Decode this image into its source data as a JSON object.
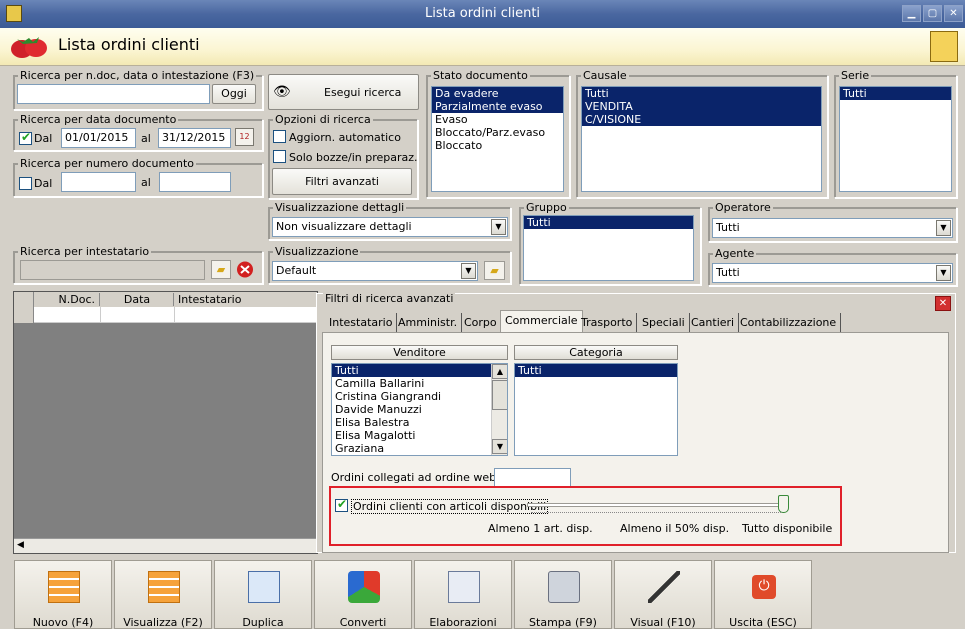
{
  "window": {
    "title": "Lista ordini clienti"
  },
  "header": {
    "title": "Lista ordini clienti"
  },
  "search_general": {
    "legend": "Ricerca per n.doc, data o intestazione (F3)",
    "value": "",
    "today_btn": "Oggi"
  },
  "run_search": {
    "label": "Esegui ricerca"
  },
  "search_date": {
    "legend": "Ricerca per data documento",
    "from_label": "Dal",
    "from": "01/01/2015",
    "to_label": "al",
    "to": "31/12/2015"
  },
  "search_number": {
    "legend": "Ricerca per numero documento",
    "from_label": "Dal",
    "to_label": "al"
  },
  "options": {
    "legend": "Opzioni di ricerca",
    "auto_update": "Aggiorn. automatico",
    "drafts_only": "Solo bozze/in preparaz.",
    "advanced_btn": "Filtri avanzati"
  },
  "doc_state": {
    "legend": "Stato documento",
    "items": [
      "Da evadere",
      "Parzialmente evaso",
      "Evaso",
      "Bloccato/Parz.evaso",
      "Bloccato"
    ],
    "selected": [
      0,
      1
    ]
  },
  "causale": {
    "legend": "Causale",
    "items": [
      "Tutti",
      "VENDITA",
      "C/VISIONE"
    ]
  },
  "serie": {
    "legend": "Serie",
    "items": [
      "Tutti"
    ]
  },
  "details": {
    "legend": "Visualizzazione dettagli",
    "value": "Non visualizzare dettagli"
  },
  "gruppo": {
    "legend": "Gruppo",
    "items": [
      "Tutti"
    ]
  },
  "operatore": {
    "legend": "Operatore",
    "value": "Tutti"
  },
  "intestatario": {
    "legend": "Ricerca per intestatario"
  },
  "visualizzazione": {
    "legend": "Visualizzazione",
    "value": "Default"
  },
  "agente": {
    "legend": "Agente",
    "value": "Tutti"
  },
  "grid": {
    "columns": [
      "N.Doc.",
      "Data",
      "Intestatario"
    ]
  },
  "advanced": {
    "legend": "Filtri di ricerca avanzati",
    "tabs": [
      "Intestatario",
      "Amministr.",
      "Corpo",
      "Commerciale",
      "Trasporto",
      "Speciali",
      "Cantieri",
      "Contabilizzazione"
    ],
    "venditore_header": "Venditore",
    "venditori": [
      "Tutti",
      "Camilla Ballarini",
      "Cristina Giangrandi",
      "Davide Manuzzi",
      "Elisa Balestra",
      "Elisa Magalotti",
      "Graziana"
    ],
    "categoria_header": "Categoria",
    "categorie": [
      "Tutti"
    ],
    "web_label": "Ordini collegati ad ordine web N.",
    "available_label": "Ordini clienti con articoli disponibili",
    "slider_labels": [
      "Almeno 1 art. disp.",
      "Almeno il 50% disp.",
      "Tutto disponibile"
    ],
    "slider_level": 1.0
  },
  "toolbar": {
    "buttons": [
      "Nuovo (F4)",
      "Visualizza (F2)",
      "Duplica",
      "Converti",
      "Elaborazioni",
      "Stampa (F9)",
      "Visual (F10)",
      "Uscita (ESC)"
    ]
  },
  "colors": {
    "selection": "#0a246a",
    "highlight_box": "#e0202a",
    "title_bar": "#4a67a0"
  }
}
